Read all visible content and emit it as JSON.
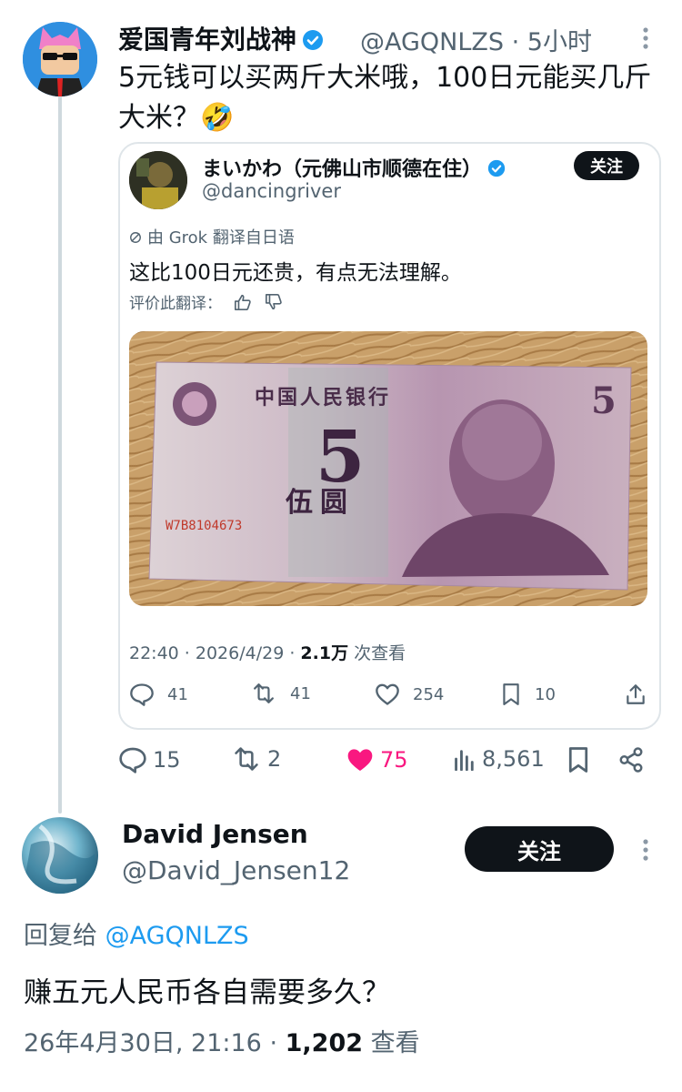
{
  "tweet": {
    "author_name": "爱国青年刘战神",
    "handle": "@AGQNLZS",
    "time": "· 5小时",
    "text": "5元钱可以买两斤大米哦，100日元能买几斤大米？🤣",
    "stats": {
      "replies": "15",
      "retweets": "2",
      "likes": "75",
      "views": "8,561"
    },
    "like_color": "#f91880"
  },
  "quote": {
    "author_name": "まいかわ（元佛山市顺德在住）",
    "handle": "@dancingriver",
    "follow_label": "关注",
    "grok_label": "由 Grok 翻译自日语",
    "text": "这比100日元还贵，有点无法理解。",
    "rate_label": "评价此翻译：",
    "meta_time": "22:40 · 2026/4/29 · ",
    "meta_views": "2.1万",
    "meta_views_suffix": " 次查看",
    "stats": {
      "replies": "41",
      "retweets": "41",
      "likes": "254",
      "bookmarks": "10"
    },
    "banknote": {
      "bank_name": "中国人民银行",
      "denomination": "5",
      "denomination_text": "伍圆",
      "serial": "W7B8104673"
    }
  },
  "reply": {
    "author_name": "David Jensen",
    "handle": "@David_Jensen12",
    "follow_label": "关注",
    "reply_prefix": "回复给 ",
    "reply_to": "@AGQNLZS",
    "text": "赚五元人民币各自需要多久？",
    "meta_time": "26年4月30日, 21:16 · ",
    "meta_views": "1,202",
    "meta_views_suffix": " 查看"
  },
  "colors": {
    "accent": "#1d9bf0",
    "text": "#0f1419",
    "muted": "#536471",
    "like": "#f91880"
  }
}
